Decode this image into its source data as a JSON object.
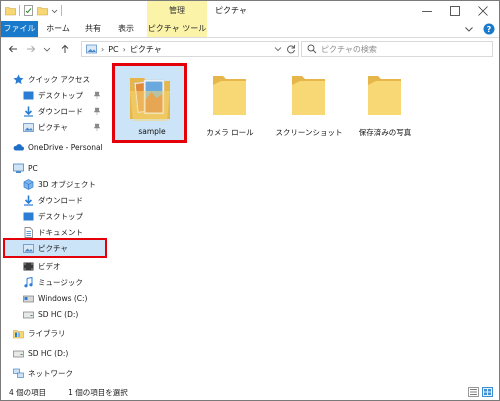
{
  "titlebar": {
    "contextual_tab_label": "管理",
    "window_title": "ピクチャ"
  },
  "ribbon": {
    "tabs": [
      "ファイル",
      "ホーム",
      "共有",
      "表示",
      "ピクチャ ツール"
    ]
  },
  "address": {
    "crumbs": [
      "PC",
      "ピクチャ"
    ]
  },
  "search": {
    "placeholder": "ピクチャの検索"
  },
  "nav": {
    "quick_access": "クイック アクセス",
    "quick_items": [
      "デスクトップ",
      "ダウンロード",
      "ピクチャ"
    ],
    "onedrive": "OneDrive - Personal",
    "pc": "PC",
    "pc_items": [
      "3D オブジェクト",
      "ダウンロード",
      "デスクトップ",
      "ドキュメント",
      "ピクチャ",
      "ビデオ",
      "ミュージック",
      "Windows (C:)",
      "SD HC (D:)"
    ],
    "library": "ライブラリ",
    "sd_card": "SD HC (D:)",
    "network": "ネットワーク"
  },
  "content": {
    "items": [
      "sample",
      "カメラ ロール",
      "スクリーンショット",
      "保存済みの写真"
    ]
  },
  "status": {
    "item_count": "4 個の項目",
    "selection": "1 個の項目を選択"
  },
  "colors": {
    "accent": "#1979ca",
    "folder": "#f8d775",
    "folder_dark": "#e6b64a",
    "selection": "#cce4f7",
    "highlight_frame": "#e3000b",
    "contextual": "#fbf4a8"
  }
}
